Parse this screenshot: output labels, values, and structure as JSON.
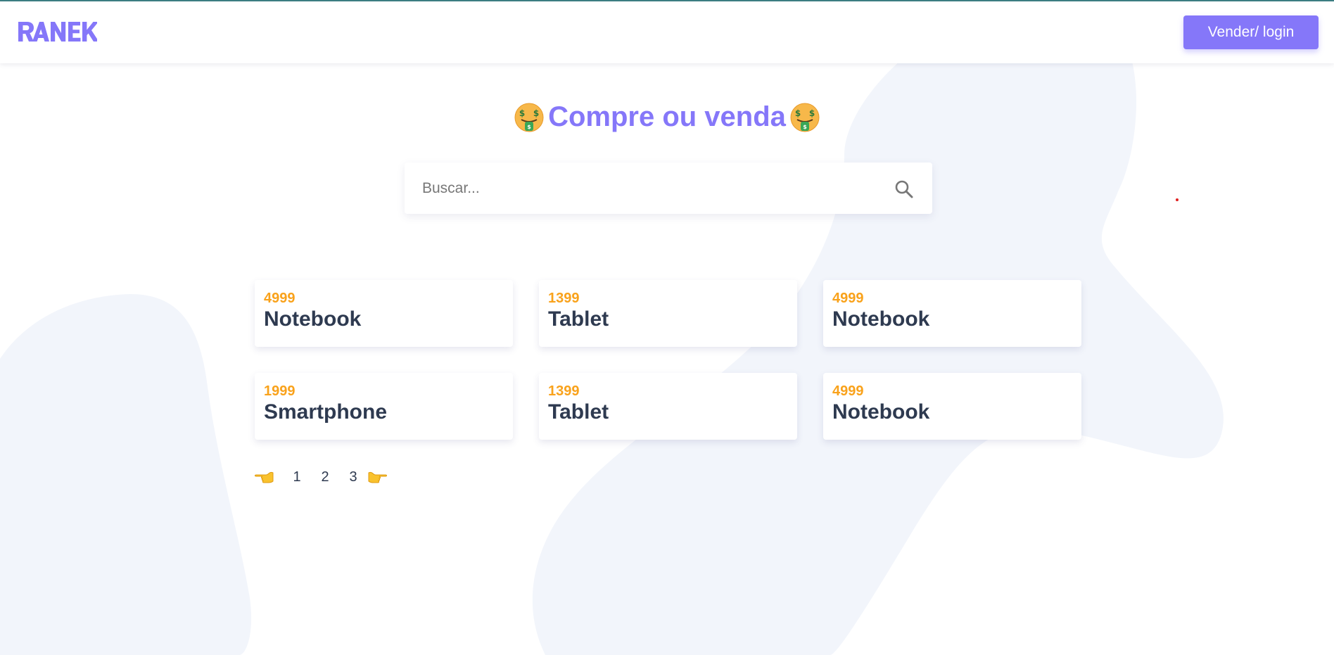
{
  "header": {
    "logo_text": "RANEK",
    "login_label": "Vender/ login"
  },
  "hero": {
    "title": "Compre ou venda",
    "emoji": "money-mouth-face-icon"
  },
  "search": {
    "placeholder": "Buscar...",
    "value": "",
    "icon": "search-icon"
  },
  "products": [
    {
      "price": "4999",
      "name": "Notebook"
    },
    {
      "price": "1399",
      "name": "Tablet"
    },
    {
      "price": "4999",
      "name": "Notebook"
    },
    {
      "price": "1999",
      "name": "Smartphone"
    },
    {
      "price": "1399",
      "name": "Tablet"
    },
    {
      "price": "4999",
      "name": "Notebook"
    }
  ],
  "pagination": {
    "prev_icon": "pointing-left-hand-icon",
    "next_icon": "pointing-right-hand-icon",
    "pages": [
      "1",
      "2",
      "3"
    ]
  },
  "colors": {
    "accent": "#8577f9",
    "price": "#f9a21b",
    "text": "#2e3a50",
    "background_blob": "#f2f5fb"
  }
}
